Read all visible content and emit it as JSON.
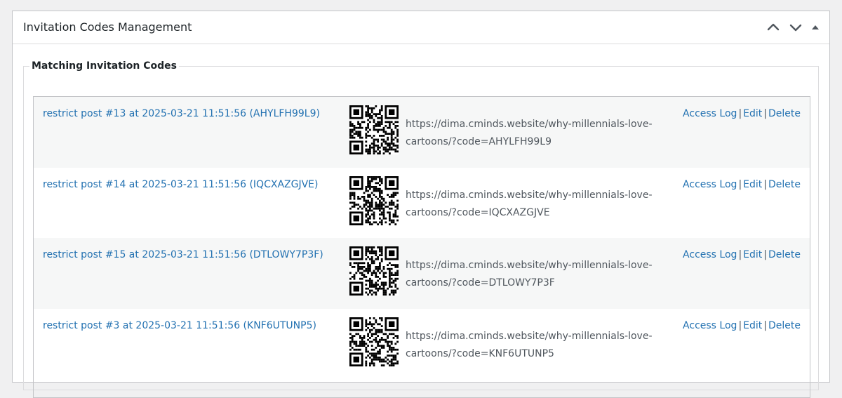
{
  "metabox": {
    "title": "Invitation Codes Management"
  },
  "section": {
    "legend": "Matching Invitation Codes"
  },
  "actions": {
    "access_log": "Access Log",
    "edit": "Edit",
    "delete": "Delete",
    "separator": "|"
  },
  "codes": [
    {
      "label": "restrict post #13 at 2025-03-21 11:51:56 (AHYLFH99L9)",
      "url": "https://dima.cminds.website/why-millennials-love-cartoons/?code=AHYLFH99L9"
    },
    {
      "label": "restrict post #14 at 2025-03-21 11:51:56 (IQCXAZGJVE)",
      "url": "https://dima.cminds.website/why-millennials-love-cartoons/?code=IQCXAZGJVE"
    },
    {
      "label": "restrict post #15 at 2025-03-21 11:51:56 (DTLOWY7P3F)",
      "url": "https://dima.cminds.website/why-millennials-love-cartoons/?code=DTLOWY7P3F"
    },
    {
      "label": "restrict post #3 at 2025-03-21 11:51:56 (KNF6UTUNP5)",
      "url": "https://dima.cminds.website/why-millennials-love-cartoons/?code=KNF6UTUNP5"
    }
  ],
  "icons": {
    "move_up": "chevron-up-icon",
    "move_down": "chevron-down-icon",
    "toggle": "caret-up-icon",
    "qr": "qr-code-icon"
  },
  "colors": {
    "link": "#2271b1",
    "alt_row": "#f6f7f7",
    "border": "#c3c4c7"
  }
}
